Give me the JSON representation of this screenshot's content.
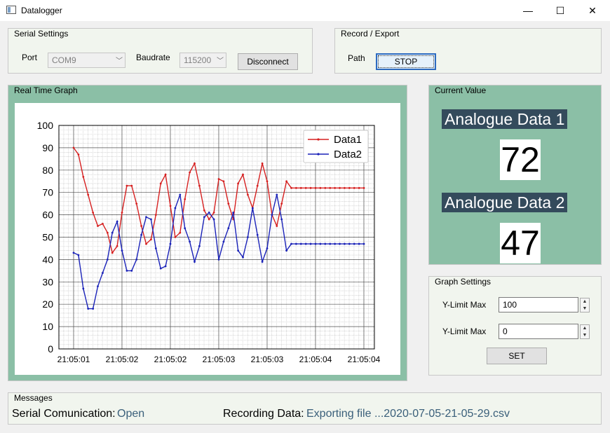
{
  "window": {
    "title": "Datalogger",
    "minimize": "—",
    "maximize": "☐",
    "close": "✕"
  },
  "serial": {
    "title": "Serial Settings",
    "port_label": "Port",
    "port_value": "COM9",
    "baud_label": "Baudrate",
    "baud_value": "115200",
    "disconnect_label": "Disconnect"
  },
  "record": {
    "title": "Record / Export",
    "path_label": "Path",
    "stop_label": "STOP"
  },
  "graph": {
    "title": "Real Time Graph"
  },
  "current": {
    "title": "Current Value",
    "label1": "Analogue Data 1",
    "value1": "72",
    "label2": "Analogue Data 2",
    "value2": "47"
  },
  "graph_settings": {
    "title": "Graph Settings",
    "ymax_label": "Y-Limit Max",
    "ymax_value": "100",
    "ymin_label": "Y-Limit Max",
    "ymin_value": "0",
    "set_label": "SET"
  },
  "messages": {
    "title": "Messages",
    "serial_label": "Serial Comunication:",
    "serial_value": "Open",
    "recording_label": "Recording Data:",
    "recording_value": "Exporting file ...2020-07-05-21-05-29.csv"
  },
  "chart_data": {
    "type": "line",
    "title": "",
    "xlabel": "",
    "ylabel": "",
    "ylim": [
      0,
      100
    ],
    "yticks": [
      0,
      10,
      20,
      30,
      40,
      50,
      60,
      70,
      80,
      90,
      100
    ],
    "xtick_labels": [
      "21:05:01",
      "21:05:02",
      "21:05:02",
      "21:05:03",
      "21:05:03",
      "21:05:04",
      "21:05:04"
    ],
    "grid": true,
    "legend": "top-right",
    "series": [
      {
        "name": "Data1",
        "color": "#d62020",
        "values": [
          90,
          87,
          77,
          69,
          61,
          55,
          56,
          52,
          43,
          46,
          61,
          73,
          73,
          65,
          55,
          47,
          49,
          60,
          74,
          78,
          64,
          50,
          52,
          67,
          79,
          83,
          73,
          62,
          58,
          61,
          76,
          75,
          65,
          58,
          74,
          78,
          69,
          63,
          73,
          83,
          75,
          60,
          55,
          65,
          75,
          72,
          72,
          72,
          72,
          72,
          72,
          72,
          72,
          72,
          72,
          72,
          72,
          72,
          72,
          72,
          72
        ]
      },
      {
        "name": "Data2",
        "color": "#1a22b8",
        "values": [
          43,
          42,
          27,
          18,
          18,
          28,
          34,
          40,
          52,
          57,
          44,
          35,
          35,
          40,
          51,
          59,
          58,
          45,
          36,
          37,
          47,
          63,
          69,
          54,
          48,
          39,
          46,
          59,
          61,
          58,
          40,
          48,
          54,
          61,
          44,
          41,
          50,
          63,
          51,
          39,
          45,
          60,
          69,
          58,
          44,
          47,
          47,
          47,
          47,
          47,
          47,
          47,
          47,
          47,
          47,
          47,
          47,
          47,
          47,
          47,
          47
        ]
      }
    ]
  }
}
